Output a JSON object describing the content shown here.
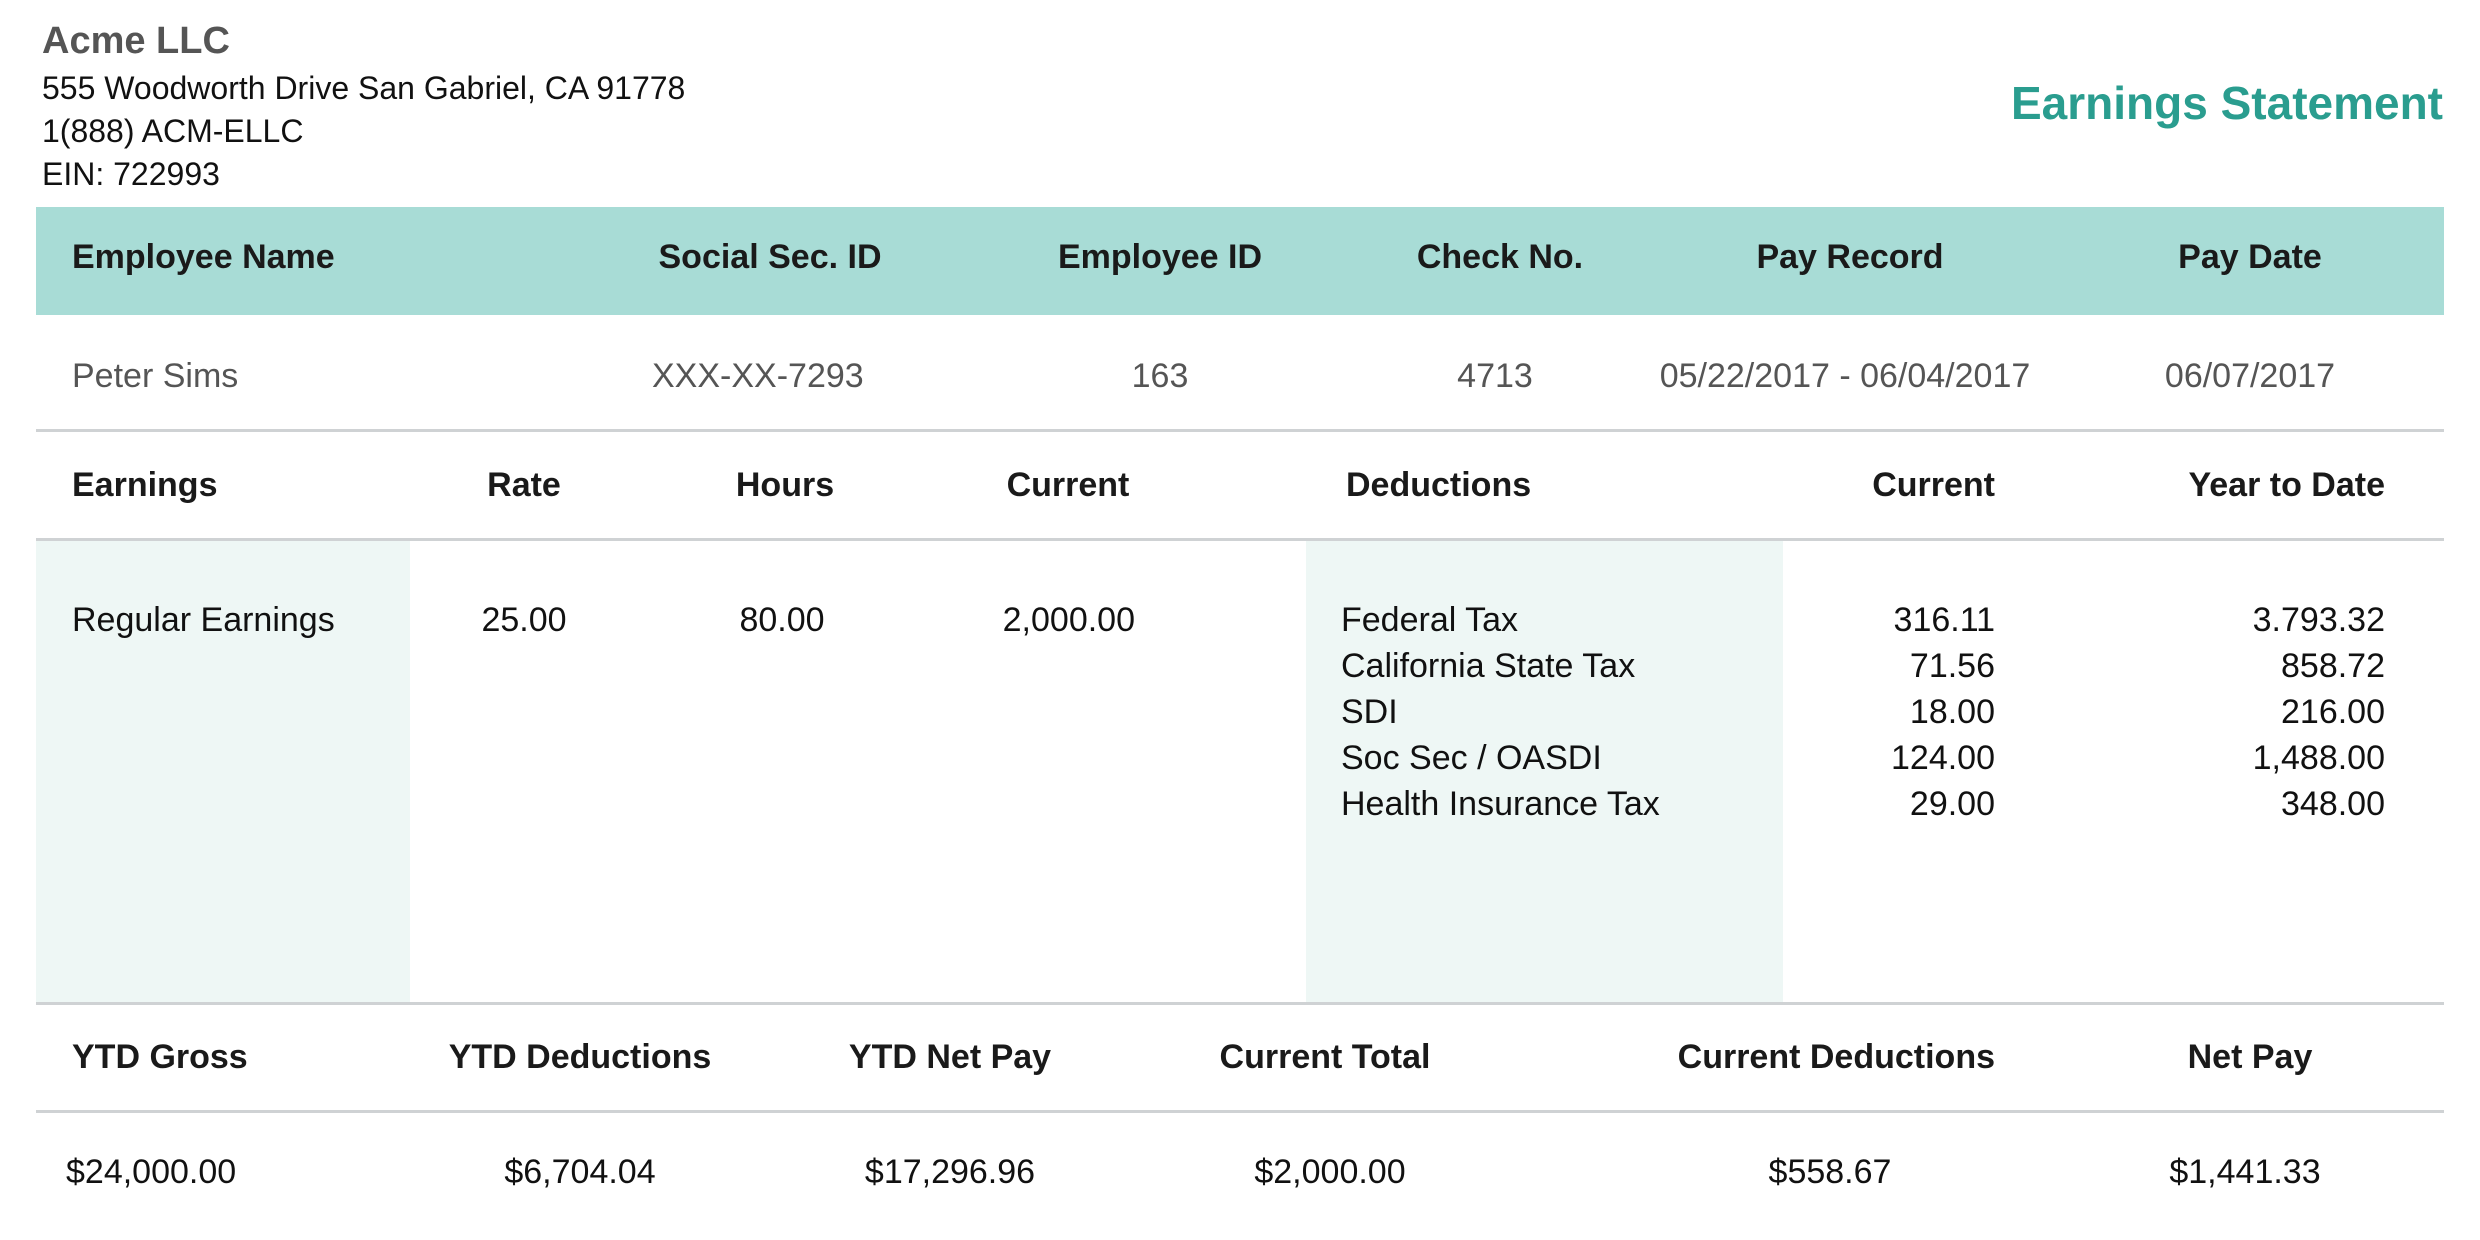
{
  "company": {
    "name": "Acme LLC",
    "address": "555 Woodworth Drive San Gabriel, CA  91778",
    "phone": "1(888) ACM-ELLC",
    "ein": "EIN: 722993"
  },
  "document_title": "Earnings Statement",
  "employee_header": {
    "name_label": "Employee Name",
    "ssn_label": "Social Sec. ID",
    "id_label": "Employee ID",
    "check_label": "Check No.",
    "record_label": "Pay Record",
    "date_label": "Pay Date"
  },
  "employee": {
    "name": "Peter Sims",
    "ssn": "XXX-XX-7293",
    "id": "163",
    "check": "4713",
    "record": "05/22/2017 - 06/04/2017",
    "date": "06/07/2017"
  },
  "details_header": {
    "earnings": "Earnings",
    "rate": "Rate",
    "hours": "Hours",
    "current": "Current",
    "deductions": "Deductions",
    "ded_current": "Current",
    "ytd": "Year to Date"
  },
  "earnings": [
    {
      "label": "Regular Earnings",
      "rate": "25.00",
      "hours": "80.00",
      "current": "2,000.00"
    }
  ],
  "deductions": [
    {
      "label": "Federal Tax",
      "current": "316.11",
      "ytd": "3.793.32"
    },
    {
      "label": "California State Tax",
      "current": "71.56",
      "ytd": "858.72"
    },
    {
      "label": "SDI",
      "current": "18.00",
      "ytd": "216.00"
    },
    {
      "label": "Soc Sec / OASDI",
      "current": "124.00",
      "ytd": "1,488.00"
    },
    {
      "label": "Health Insurance Tax",
      "current": "29.00",
      "ytd": "348.00"
    }
  ],
  "totals_header": {
    "ytd_gross": "YTD Gross",
    "ytd_deductions": "YTD Deductions",
    "ytd_net": "YTD Net Pay",
    "current_total": "Current Total",
    "current_deductions": "Current Deductions",
    "net_pay": "Net Pay"
  },
  "totals": {
    "ytd_gross": "$24,000.00",
    "ytd_deductions": "$6,704.04",
    "ytd_net": "$17,296.96",
    "current_total": "$2,000.00",
    "current_deductions": "$558.67",
    "net_pay": "$1,441.33"
  }
}
